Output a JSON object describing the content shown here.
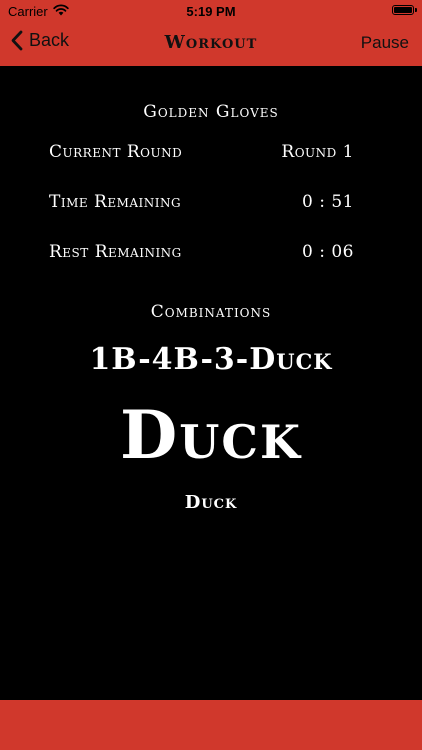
{
  "status_bar": {
    "carrier": "Carrier",
    "time": "5:19 PM",
    "wifi_icon": "wifi-icon",
    "battery_icon": "battery-icon",
    "battery_level": 1.0
  },
  "nav": {
    "back_label": "Back",
    "back_icon": "chevron-left-icon",
    "title": "Workout",
    "pause_label": "Pause"
  },
  "workout": {
    "program_title": "Golden Gloves",
    "rows": [
      {
        "label": "Current Round",
        "value": "Round 1"
      },
      {
        "label": "Time Remaining",
        "value": "0 : 51"
      },
      {
        "label": "Rest Remaining",
        "value": "0 : 06"
      }
    ],
    "combinations_label": "Combinations",
    "combination_sequence": "1B-4B-3-Duck",
    "current_move": "Duck",
    "next_move": "Duck"
  },
  "colors": {
    "header_red": "#d0382c",
    "background": "#000000",
    "text": "#ffffff"
  }
}
